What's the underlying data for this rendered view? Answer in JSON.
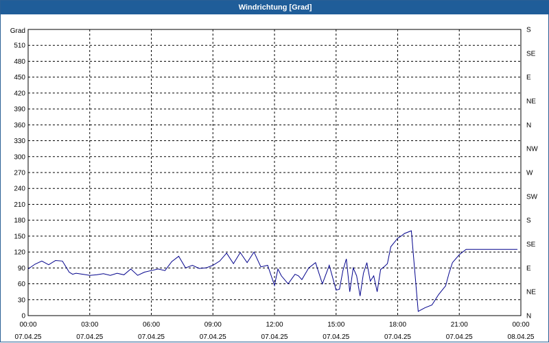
{
  "window": {
    "title": "Windrichtung [Grad]"
  },
  "colors": {
    "titlebar": "#1f5d99",
    "line": "#00008b",
    "grid": "#000000"
  },
  "chart_data": {
    "type": "line",
    "title": "Windrichtung [Grad]",
    "ylabel": "Grad",
    "ylim": [
      0,
      540
    ],
    "xlim": [
      "2025-04-07 00:00",
      "2025-04-08 00:00"
    ],
    "grid": true,
    "y_ticks": [
      0,
      30,
      60,
      90,
      120,
      150,
      180,
      210,
      240,
      270,
      300,
      330,
      360,
      390,
      420,
      450,
      480,
      510
    ],
    "y_tick_labels": [
      "0",
      "30",
      "60",
      "90",
      "120",
      "150",
      "180",
      "210",
      "240",
      "270",
      "300",
      "330",
      "360",
      "390",
      "420",
      "450",
      "480",
      "510"
    ],
    "right_ticks": [
      0,
      45,
      90,
      135,
      180,
      225,
      270,
      315,
      360,
      405,
      450,
      495,
      540
    ],
    "right_tick_labels": [
      "N",
      "NE",
      "E",
      "SE",
      "S",
      "SW",
      "W",
      "NW",
      "N",
      "NE",
      "E",
      "SE",
      "S"
    ],
    "x_ticks": [
      "00:00",
      "03:00",
      "06:00",
      "09:00",
      "12:00",
      "15:00",
      "18:00",
      "21:00",
      "00:00"
    ],
    "x_tick_dates": [
      "07.04.25",
      "07.04.25",
      "07.04.25",
      "07.04.25",
      "07.04.25",
      "07.04.25",
      "07.04.25",
      "07.04.25",
      "08.04.25"
    ],
    "series": [
      {
        "x": [
          "00:00",
          "00:20",
          "00:40",
          "01:00",
          "01:20",
          "01:40",
          "02:00",
          "02:10",
          "02:20",
          "02:40",
          "03:00",
          "03:20",
          "03:40",
          "04:00",
          "04:20",
          "04:40",
          "05:00",
          "05:20",
          "05:40",
          "06:00",
          "06:20",
          "06:40",
          "07:00",
          "07:20",
          "07:40",
          "08:00",
          "08:20",
          "08:40",
          "09:00",
          "09:20",
          "09:40",
          "10:00",
          "10:20",
          "10:40",
          "11:00",
          "11:20",
          "11:40",
          "12:00",
          "12:10",
          "12:20",
          "12:40",
          "13:00",
          "13:10",
          "13:20",
          "13:40",
          "14:00",
          "14:20",
          "14:40",
          "15:00",
          "15:10",
          "15:20",
          "15:30",
          "15:40",
          "15:50",
          "16:00",
          "16:10",
          "16:20",
          "16:30",
          "16:40",
          "16:50",
          "17:00",
          "17:10",
          "17:20",
          "17:30",
          "17:40",
          "17:50",
          "18:00",
          "18:10",
          "18:20",
          "18:40",
          "19:00",
          "19:20",
          "19:40",
          "20:00",
          "20:10",
          "20:15",
          "20:20",
          "20:30",
          "20:40",
          "21:00",
          "21:20",
          "21:40",
          "22:00",
          "22:20",
          "22:40",
          "23:00",
          "23:20",
          "23:40",
          "23:50"
        ],
        "y": [
          88,
          97,
          103,
          96,
          104,
          103,
          82,
          78,
          80,
          78,
          76,
          77,
          79,
          76,
          80,
          77,
          88,
          76,
          82,
          85,
          88,
          85,
          102,
          112,
          90,
          95,
          89,
          90,
          95,
          103,
          118,
          98,
          119,
          100,
          120,
          92,
          95,
          57,
          88,
          75,
          60,
          78,
          75,
          68,
          90,
          100,
          60,
          95,
          48,
          50,
          85,
          107,
          45,
          90,
          75,
          37,
          80,
          100,
          65,
          75,
          45,
          87,
          92,
          98,
          130,
          138,
          146,
          150,
          155,
          160,
          8,
          15,
          20,
          40,
          48,
          52,
          56,
          80,
          100,
          115,
          125,
          125,
          125,
          125,
          125,
          125,
          125,
          125,
          125
        ]
      }
    ]
  }
}
